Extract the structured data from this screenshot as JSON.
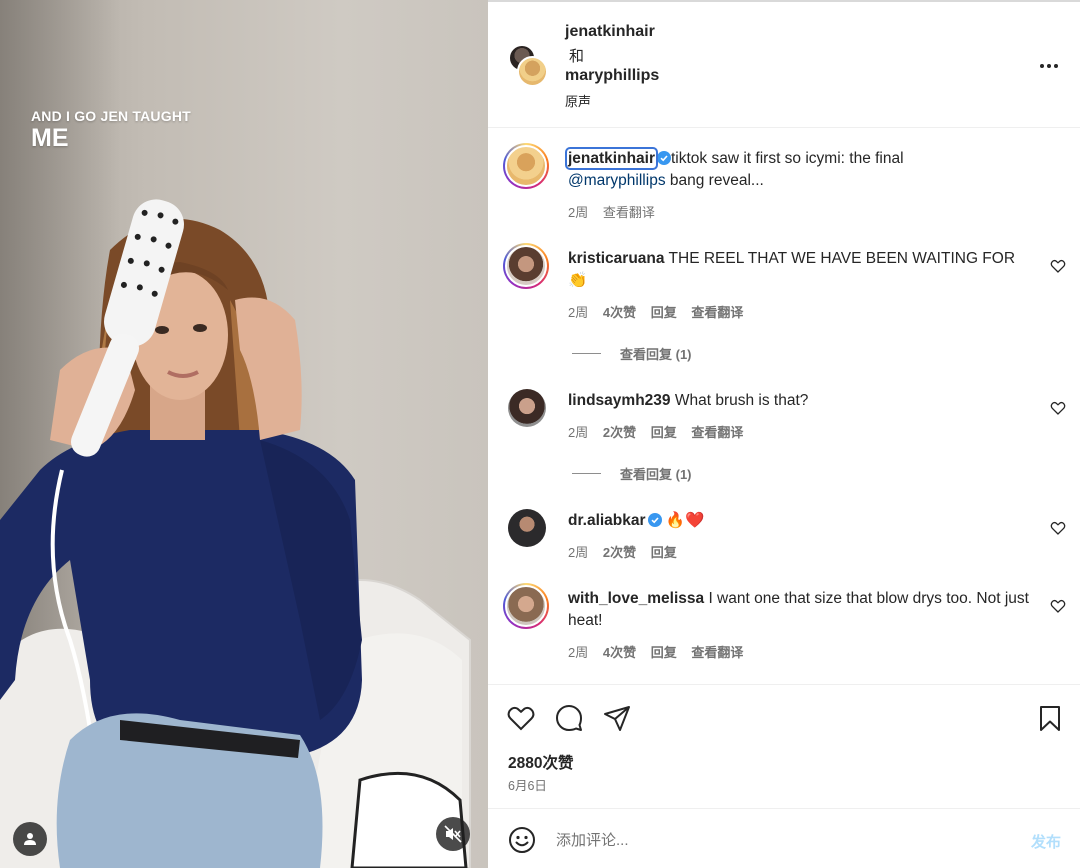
{
  "video": {
    "caption_line1": "AND I GO JEN TAUGHT",
    "caption_line2": "ME",
    "buttons": {
      "profile_icon": "user-icon",
      "mute_icon": "speaker-muted-icon"
    }
  },
  "post_header": {
    "user1": "jenatkinhair",
    "and_text": "和",
    "user2": "maryphillips",
    "audio_label": "原声",
    "more_icon": "more-horizontal-icon"
  },
  "caption": {
    "username": "jenatkinhair",
    "verified": true,
    "text_before": "tiktok saw it first so icymi: the final",
    "mention": "@maryphillips",
    "text_after": " bang reveal...",
    "time": "2周",
    "translate": "查看翻译"
  },
  "comments": [
    {
      "username": "kristicaruana",
      "text": "THE REEL THAT WE HAVE BEEN WAITING FOR 👏",
      "time": "2周",
      "likes": "4次赞",
      "reply": "回复",
      "translate": "查看翻译",
      "view_replies": "查看回复 (1)"
    },
    {
      "username": "lindsaymh239",
      "text": "What brush is that?",
      "time": "2周",
      "likes": "2次赞",
      "reply": "回复",
      "translate": "查看翻译",
      "view_replies": "查看回复 (1)"
    },
    {
      "username": "dr.aliabkar",
      "verified": true,
      "text": "🔥❤️",
      "time": "2周",
      "likes": "2次赞",
      "reply": "回复"
    },
    {
      "username": "with_love_melissa",
      "text": "I want one that size that blow drys too. Not just heat!",
      "time": "2周",
      "likes": "4次赞",
      "reply": "回复",
      "translate": "查看翻译"
    }
  ],
  "actions": {
    "icons": [
      "heart-icon",
      "comment-icon",
      "share-icon",
      "bookmark-icon"
    ],
    "likes": "2880次赞",
    "date": "6月6日"
  },
  "add_comment": {
    "placeholder": "添加评论...",
    "post_label": "发布",
    "emoji_icon": "emoji-icon"
  },
  "colors": {
    "link": "#00376b",
    "secondary_text": "#737373",
    "post_button_disabled": "#b2dffc",
    "verified": "#3897f0"
  }
}
